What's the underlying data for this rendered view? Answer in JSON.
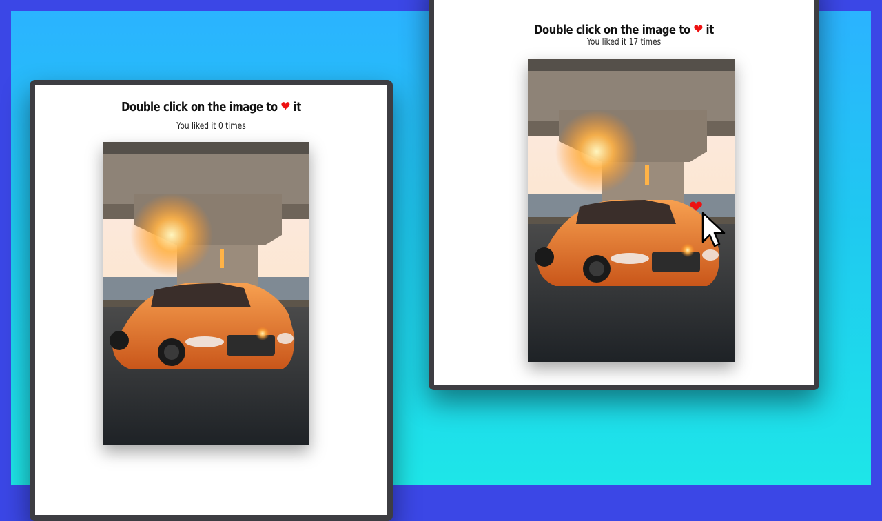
{
  "cards": [
    {
      "title_prefix": "Double click on the image to",
      "title_suffix": "it",
      "heart_glyph": "❤",
      "like_count_text": "You liked it 0 times"
    },
    {
      "title_prefix": "Double click on the image to",
      "title_suffix": "it",
      "heart_glyph": "❤",
      "like_count_text": "You liked it 17 times",
      "like_heart_glyph": "❤"
    }
  ],
  "colors": {
    "outer_border": "#3b47e6",
    "background_top": "#2bb3ff",
    "background_bottom": "#1ee6e8",
    "card_border": "#3d3d42",
    "heart": "#ee1111",
    "car": "#e8762a"
  },
  "icons": {
    "heart": "heart-icon",
    "cursor": "mouse-pointer-icon"
  }
}
